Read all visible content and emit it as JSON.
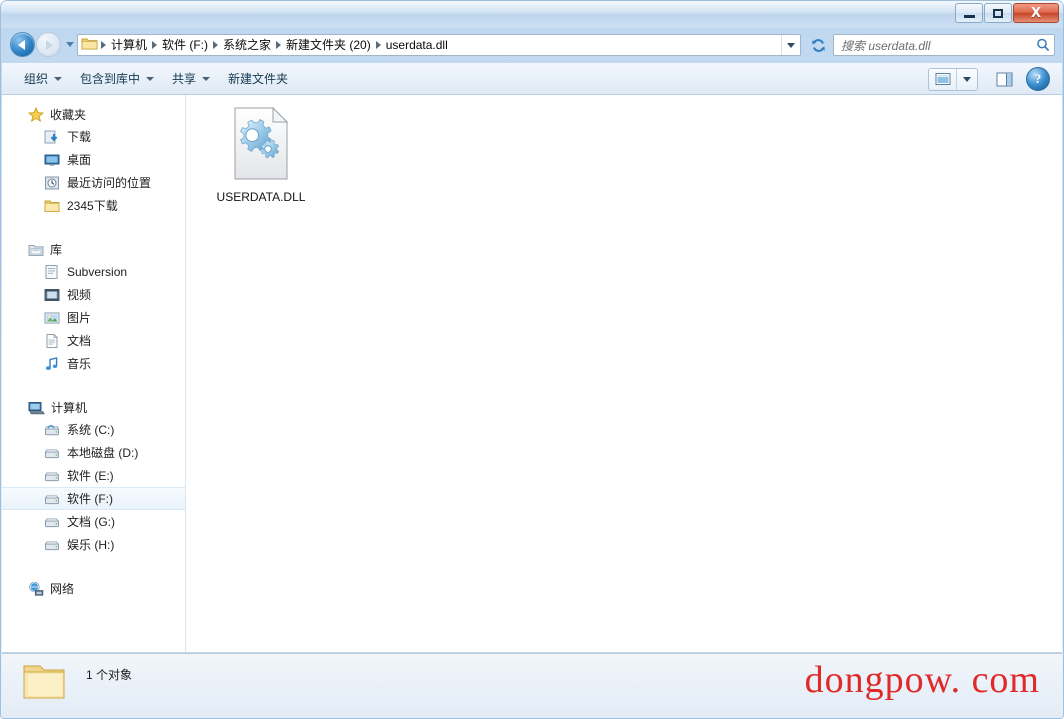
{
  "window": {
    "title": "",
    "controls": {
      "minimize": "minimize",
      "maximize": "maximize",
      "close": "X"
    }
  },
  "address": {
    "breadcrumbs": [
      {
        "label": "计算机"
      },
      {
        "label": "软件 (F:)"
      },
      {
        "label": "系统之家"
      },
      {
        "label": "新建文件夹 (20)"
      },
      {
        "label": "userdata.dll"
      }
    ],
    "dropdown_icon": "chevron-down-icon",
    "refresh_icon": "refresh-icon",
    "back_icon": "back-arrow-icon",
    "forward_icon": "forward-arrow-icon"
  },
  "search": {
    "placeholder": "搜索 userdata.dll",
    "value": "",
    "icon": "search-icon"
  },
  "toolbar": {
    "items": [
      {
        "label": "组织",
        "has_caret": true
      },
      {
        "label": "包含到库中",
        "has_caret": true
      },
      {
        "label": "共享",
        "has_caret": true
      },
      {
        "label": "新建文件夹",
        "has_caret": false
      }
    ],
    "right": {
      "view_icon": "view-layout-icon",
      "view_caret": "chevron-down-icon",
      "preview_icon": "preview-pane-icon",
      "help_label": "?"
    }
  },
  "sidebar": {
    "groups": [
      {
        "header": {
          "label": "收藏夹",
          "icon": "star-icon"
        },
        "items": [
          {
            "label": "下载",
            "icon": "downloads-icon",
            "selected": false
          },
          {
            "label": "桌面",
            "icon": "desktop-icon",
            "selected": false
          },
          {
            "label": "最近访问的位置",
            "icon": "recent-places-icon",
            "selected": false
          },
          {
            "label": "2345下载",
            "icon": "folder-icon",
            "selected": false
          }
        ]
      },
      {
        "header": {
          "label": "库",
          "icon": "library-icon"
        },
        "items": [
          {
            "label": "Subversion",
            "icon": "subversion-icon",
            "selected": false
          },
          {
            "label": "视频",
            "icon": "video-icon",
            "selected": false
          },
          {
            "label": "图片",
            "icon": "pictures-icon",
            "selected": false
          },
          {
            "label": "文档",
            "icon": "documents-icon",
            "selected": false
          },
          {
            "label": "音乐",
            "icon": "music-icon",
            "selected": false
          }
        ]
      },
      {
        "header": {
          "label": "计算机",
          "icon": "computer-icon"
        },
        "items": [
          {
            "label": "系统 (C:)",
            "icon": "system-drive-icon",
            "selected": false
          },
          {
            "label": "本地磁盘 (D:)",
            "icon": "drive-icon",
            "selected": false
          },
          {
            "label": "软件 (E:)",
            "icon": "drive-icon",
            "selected": false
          },
          {
            "label": "软件 (F:)",
            "icon": "drive-icon",
            "selected": true
          },
          {
            "label": "文档 (G:)",
            "icon": "drive-icon",
            "selected": false
          },
          {
            "label": "娱乐 (H:)",
            "icon": "drive-icon",
            "selected": false
          }
        ]
      },
      {
        "header": {
          "label": "网络",
          "icon": "network-icon"
        },
        "items": []
      }
    ]
  },
  "files": [
    {
      "name": "USERDATA.DLL",
      "icon": "dll-file-icon",
      "selected": false
    }
  ],
  "status": {
    "text": "1 个对象",
    "icon": "folder-icon"
  },
  "watermark": {
    "text": "dongpow. com",
    "color": "#e02a2a"
  }
}
